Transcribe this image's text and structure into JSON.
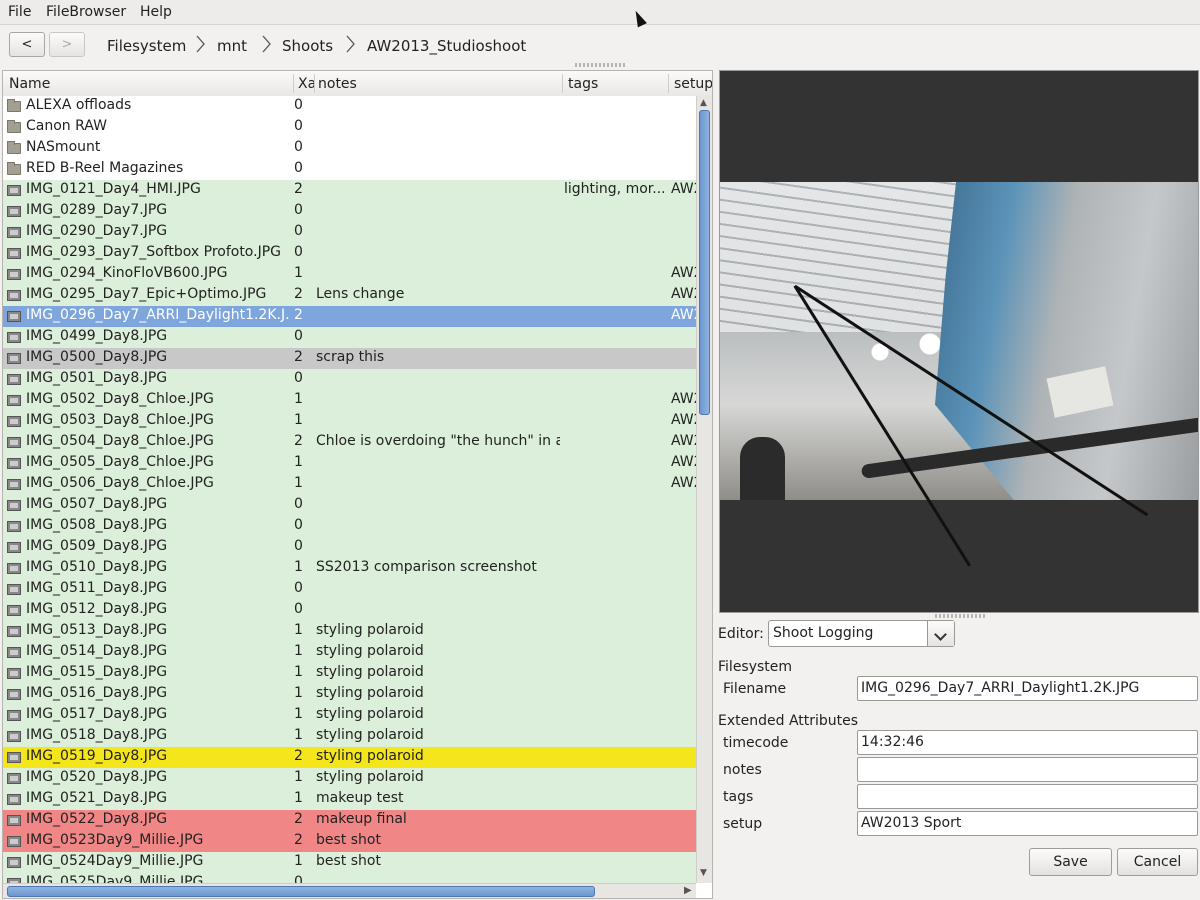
{
  "menu": [
    "File",
    "FileBrowser",
    "Help"
  ],
  "nav": {
    "back": "<",
    "forward": ">"
  },
  "breadcrumb": [
    "Filesystem",
    "mnt",
    "Shoots",
    "AW2013_Studioshoot"
  ],
  "columns": {
    "name": "Name",
    "xa": "Xa",
    "notes": "notes",
    "tags": "tags",
    "setup": "setup"
  },
  "colors": {
    "folder_bg": "#ffffff",
    "default_bg": "#dcefda",
    "selected": "#7ea6dc",
    "gray": "#c8c8c8",
    "yellow": "#f5e61c",
    "red": "#f18686"
  },
  "rows": [
    {
      "type": "folder",
      "name": "ALEXA offloads",
      "xa": "0",
      "notes": "",
      "tags": "",
      "setup": "",
      "color": "folder"
    },
    {
      "type": "folder",
      "name": "Canon RAW",
      "xa": "0",
      "notes": "",
      "tags": "",
      "setup": "",
      "color": "folder"
    },
    {
      "type": "folder",
      "name": "NASmount",
      "xa": "0",
      "notes": "",
      "tags": "",
      "setup": "",
      "color": "folder"
    },
    {
      "type": "folder",
      "name": "RED B-Reel Magazines",
      "xa": "0",
      "notes": "",
      "tags": "",
      "setup": "",
      "color": "folder"
    },
    {
      "type": "file",
      "name": "IMG_0121_Day4_HMI.JPG",
      "xa": "2",
      "notes": "",
      "tags": "lighting, mor...",
      "setup": "AW2",
      "color": "default"
    },
    {
      "type": "file",
      "name": "IMG_0289_Day7.JPG",
      "xa": "0",
      "notes": "",
      "tags": "",
      "setup": "",
      "color": "default"
    },
    {
      "type": "file",
      "name": "IMG_0290_Day7.JPG",
      "xa": "0",
      "notes": "",
      "tags": "",
      "setup": "",
      "color": "default"
    },
    {
      "type": "file",
      "name": "IMG_0293_Day7_Softbox Profoto.JPG",
      "xa": "0",
      "notes": "",
      "tags": "",
      "setup": "",
      "color": "default"
    },
    {
      "type": "file",
      "name": "IMG_0294_KinoFloVB600.JPG",
      "xa": "1",
      "notes": "",
      "tags": "",
      "setup": "AW2",
      "color": "default"
    },
    {
      "type": "file",
      "name": "IMG_0295_Day7_Epic+Optimo.JPG",
      "xa": "2",
      "notes": "Lens change",
      "tags": "",
      "setup": "AW2",
      "color": "default"
    },
    {
      "type": "file",
      "name": "IMG_0296_Day7_ARRI_Daylight1.2K.J...",
      "xa": "2",
      "notes": "",
      "tags": "",
      "setup": "AW2",
      "color": "selected"
    },
    {
      "type": "file",
      "name": "IMG_0499_Day8.JPG",
      "xa": "0",
      "notes": "",
      "tags": "",
      "setup": "",
      "color": "default"
    },
    {
      "type": "file",
      "name": "IMG_0500_Day8.JPG",
      "xa": "2",
      "notes": "scrap this",
      "tags": "",
      "setup": "",
      "color": "gray"
    },
    {
      "type": "file",
      "name": "IMG_0501_Day8.JPG",
      "xa": "0",
      "notes": "",
      "tags": "",
      "setup": "",
      "color": "default"
    },
    {
      "type": "file",
      "name": "IMG_0502_Day8_Chloe.JPG",
      "xa": "1",
      "notes": "",
      "tags": "",
      "setup": "AW2",
      "color": "default"
    },
    {
      "type": "file",
      "name": "IMG_0503_Day8_Chloe.JPG",
      "xa": "1",
      "notes": "",
      "tags": "",
      "setup": "AW2",
      "color": "default"
    },
    {
      "type": "file",
      "name": "IMG_0504_Day8_Chloe.JPG",
      "xa": "2",
      "notes": "Chloe is overdoing \"the hunch\" in a...",
      "tags": "",
      "setup": "AW2",
      "color": "default"
    },
    {
      "type": "file",
      "name": "IMG_0505_Day8_Chloe.JPG",
      "xa": "1",
      "notes": "",
      "tags": "",
      "setup": "AW2",
      "color": "default"
    },
    {
      "type": "file",
      "name": "IMG_0506_Day8_Chloe.JPG",
      "xa": "1",
      "notes": "",
      "tags": "",
      "setup": "AW2",
      "color": "default"
    },
    {
      "type": "file",
      "name": "IMG_0507_Day8.JPG",
      "xa": "0",
      "notes": "",
      "tags": "",
      "setup": "",
      "color": "default"
    },
    {
      "type": "file",
      "name": "IMG_0508_Day8.JPG",
      "xa": "0",
      "notes": "",
      "tags": "",
      "setup": "",
      "color": "default"
    },
    {
      "type": "file",
      "name": "IMG_0509_Day8.JPG",
      "xa": "0",
      "notes": "",
      "tags": "",
      "setup": "",
      "color": "default"
    },
    {
      "type": "file",
      "name": "IMG_0510_Day8.JPG",
      "xa": "1",
      "notes": "SS2013 comparison screenshot",
      "tags": "",
      "setup": "",
      "color": "default"
    },
    {
      "type": "file",
      "name": "IMG_0511_Day8.JPG",
      "xa": "0",
      "notes": "",
      "tags": "",
      "setup": "",
      "color": "default"
    },
    {
      "type": "file",
      "name": "IMG_0512_Day8.JPG",
      "xa": "0",
      "notes": "",
      "tags": "",
      "setup": "",
      "color": "default"
    },
    {
      "type": "file",
      "name": "IMG_0513_Day8.JPG",
      "xa": "1",
      "notes": "styling polaroid",
      "tags": "",
      "setup": "",
      "color": "default"
    },
    {
      "type": "file",
      "name": "IMG_0514_Day8.JPG",
      "xa": "1",
      "notes": "styling polaroid",
      "tags": "",
      "setup": "",
      "color": "default"
    },
    {
      "type": "file",
      "name": "IMG_0515_Day8.JPG",
      "xa": "1",
      "notes": "styling polaroid",
      "tags": "",
      "setup": "",
      "color": "default"
    },
    {
      "type": "file",
      "name": "IMG_0516_Day8.JPG",
      "xa": "1",
      "notes": "styling polaroid",
      "tags": "",
      "setup": "",
      "color": "default"
    },
    {
      "type": "file",
      "name": "IMG_0517_Day8.JPG",
      "xa": "1",
      "notes": "styling polaroid",
      "tags": "",
      "setup": "",
      "color": "default"
    },
    {
      "type": "file",
      "name": "IMG_0518_Day8.JPG",
      "xa": "1",
      "notes": "styling polaroid",
      "tags": "",
      "setup": "",
      "color": "default"
    },
    {
      "type": "file",
      "name": "IMG_0519_Day8.JPG",
      "xa": "2",
      "notes": "styling polaroid",
      "tags": "",
      "setup": "",
      "color": "yellow"
    },
    {
      "type": "file",
      "name": "IMG_0520_Day8.JPG",
      "xa": "1",
      "notes": "styling polaroid",
      "tags": "",
      "setup": "",
      "color": "default"
    },
    {
      "type": "file",
      "name": "IMG_0521_Day8.JPG",
      "xa": "1",
      "notes": "makeup test",
      "tags": "",
      "setup": "",
      "color": "default"
    },
    {
      "type": "file",
      "name": "IMG_0522_Day8.JPG",
      "xa": "2",
      "notes": "makeup final",
      "tags": "",
      "setup": "",
      "color": "red"
    },
    {
      "type": "file",
      "name": "IMG_0523Day9_Millie.JPG",
      "xa": "2",
      "notes": "best shot",
      "tags": "",
      "setup": "",
      "color": "red"
    },
    {
      "type": "file",
      "name": "IMG_0524Day9_Millie.JPG",
      "xa": "1",
      "notes": "best shot",
      "tags": "",
      "setup": "",
      "color": "default"
    },
    {
      "type": "file",
      "name": "IMG_0525Day9_Millie.JPG",
      "xa": "0",
      "notes": "",
      "tags": "",
      "setup": "",
      "color": "default"
    }
  ],
  "editor": {
    "label": "Editor:",
    "selected": "Shoot Logging",
    "section_filesystem": "Filesystem",
    "filename_label": "Filename",
    "filename_value": "IMG_0296_Day7_ARRI_Daylight1.2K.JPG",
    "section_xattr": "Extended Attributes",
    "timecode_label": "timecode",
    "timecode_value": "14:32:46",
    "notes_label": "notes",
    "notes_value": "",
    "tags_label": "tags",
    "tags_value": "",
    "setup_label": "setup",
    "setup_value": "AW2013 Sport",
    "save": "Save",
    "cancel": "Cancel"
  }
}
